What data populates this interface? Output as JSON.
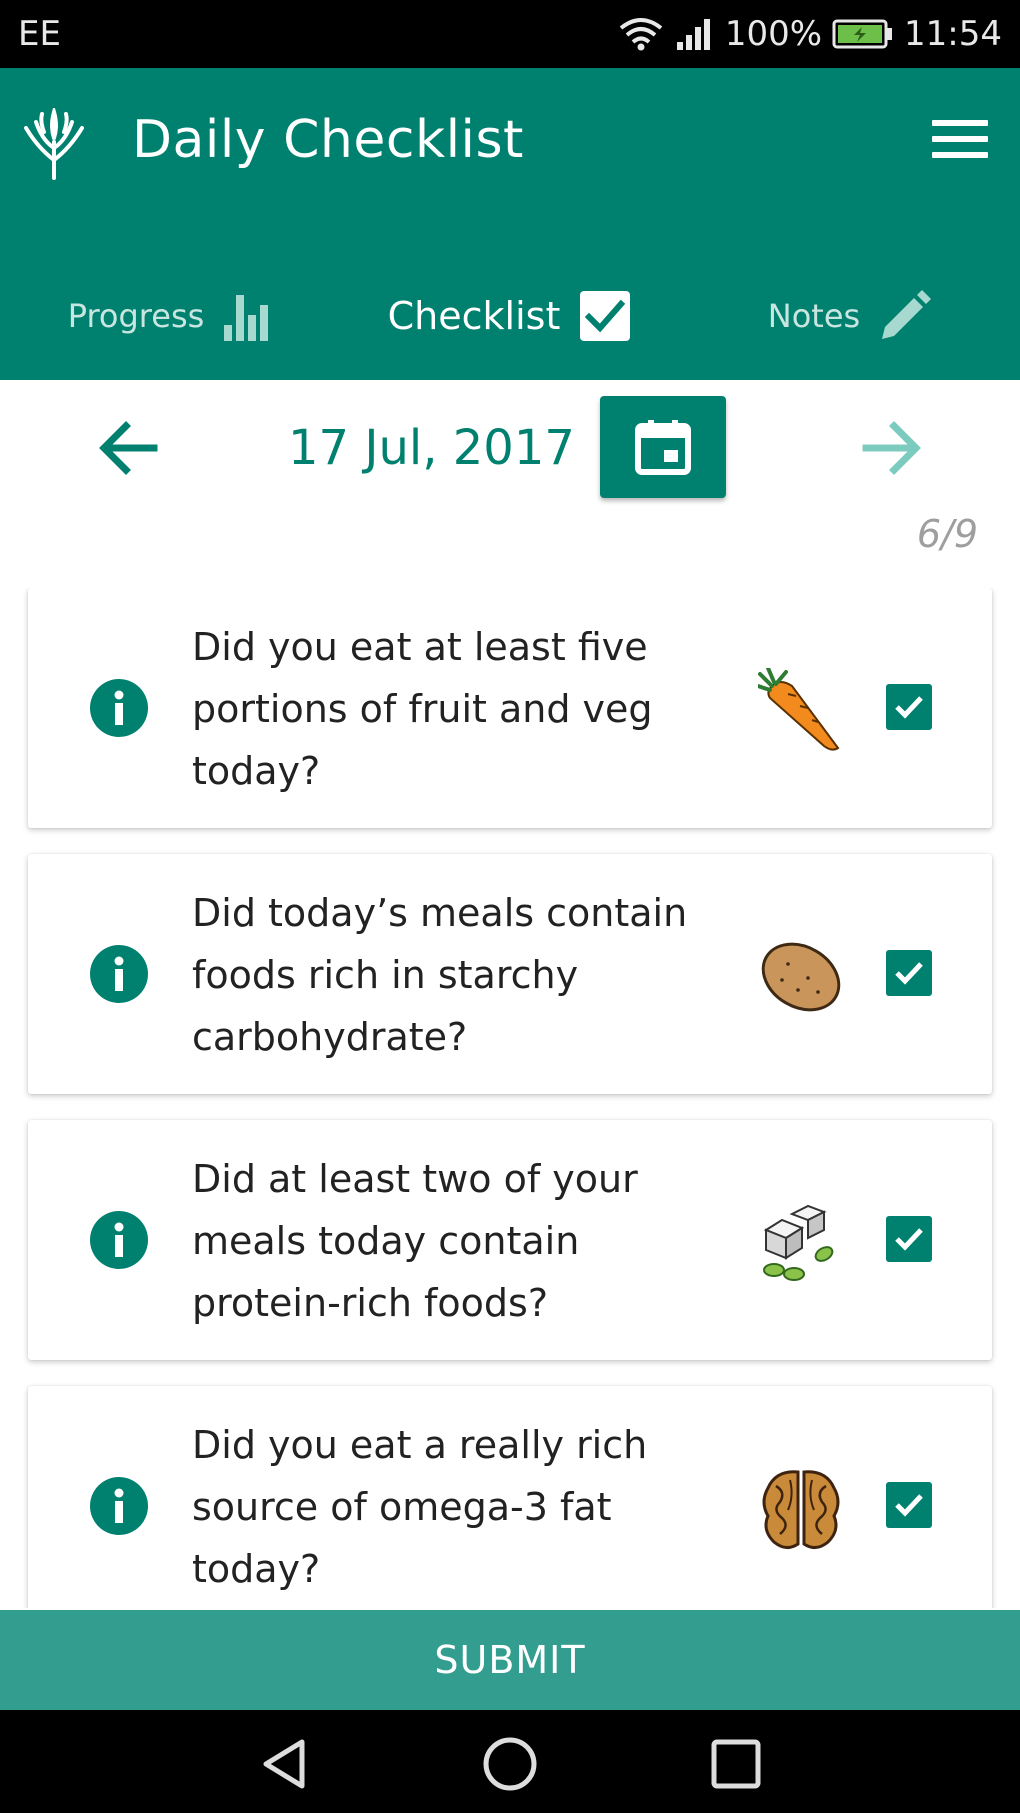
{
  "status_bar": {
    "carrier": "EE",
    "battery": "100%",
    "time": "11:54"
  },
  "app_bar": {
    "title": "Daily Checklist",
    "logo_icon": "plant-logo-icon",
    "menu_icon": "hamburger-menu-icon"
  },
  "tabs": [
    {
      "label": "Progress",
      "icon": "bar-chart-icon"
    },
    {
      "label": "Checklist",
      "icon": "checkbox-icon"
    },
    {
      "label": "Notes",
      "icon": "pencil-icon"
    }
  ],
  "date_nav": {
    "date": "17 Jul, 2017",
    "prev_icon": "arrow-left-icon",
    "next_icon": "arrow-right-icon",
    "calendar_icon": "calendar-icon"
  },
  "progress_counter": "6/9",
  "questions": [
    {
      "text": "Did you eat at least five portions of fruit and veg today?",
      "food_icon": "carrot-icon",
      "checked": true
    },
    {
      "text": "Did today’s meals contain foods rich in starchy carbohydrate?",
      "food_icon": "potato-icon",
      "checked": true
    },
    {
      "text": "Did at least two of your meals today contain protein-rich foods?",
      "food_icon": "tofu-beans-icon",
      "checked": true
    },
    {
      "text": "Did you eat a really rich source of omega-3 fat today?",
      "food_icon": "walnut-icon",
      "checked": true
    }
  ],
  "submit_label": "SUBMIT",
  "colors": {
    "primary": "#00806f",
    "submit": "#339e8f",
    "accent_light": "#7ccbbf"
  }
}
